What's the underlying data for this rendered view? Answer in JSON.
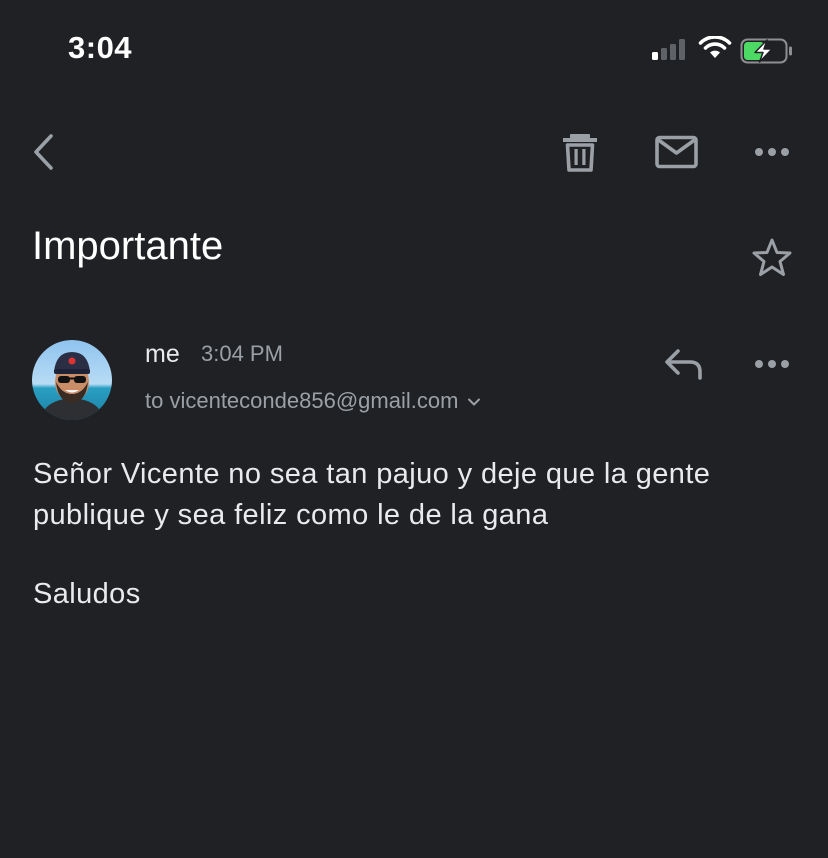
{
  "status_bar": {
    "time": "3:04",
    "signal_bars_on": 1,
    "signal_bars_total": 4,
    "battery_level": 0.5,
    "battery_charging": true,
    "battery_color": "#4cd964"
  },
  "toolbar": {
    "back_icon": "chevron-left-icon",
    "delete_icon": "trash-icon",
    "mark_unread_icon": "mail-icon",
    "more_icon": "more-horizontal-icon"
  },
  "message": {
    "subject": "Importante",
    "starred": false,
    "sender": {
      "name": "me",
      "time": "3:04 PM",
      "recipient_text": "to vicenteconde856@gmail.com",
      "avatar_icon": "avatar-photo"
    },
    "body": "Señor Vicente no sea tan pajuo y deje que la gente publique y sea feliz como le de la gana",
    "sign_off": "Saludos"
  },
  "colors": {
    "background": "#202124",
    "primary_text": "#e8eaed",
    "secondary_text": "#9aa0a6",
    "icon": "#9aa0a6"
  }
}
